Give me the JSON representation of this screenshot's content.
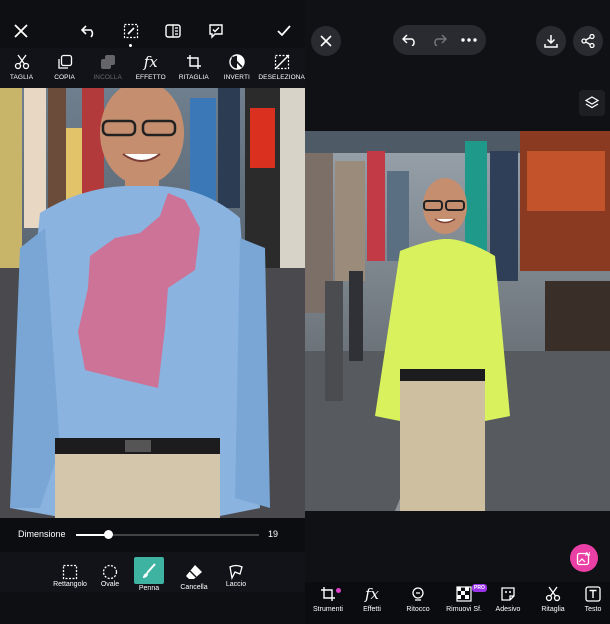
{
  "left": {
    "toolbar_tools": [
      {
        "label": "TAGLIA",
        "icon": "scissors-icon"
      },
      {
        "label": "COPIA",
        "icon": "copy-icon"
      },
      {
        "label": "INCOLLA",
        "icon": "paste-icon"
      },
      {
        "label": "EFFETTO",
        "icon": "fx-icon"
      },
      {
        "label": "RITAGLIA",
        "icon": "crop-icon"
      },
      {
        "label": "INVERTI",
        "icon": "invert-icon"
      },
      {
        "label": "DESELEZIONA",
        "icon": "deselect-icon"
      }
    ],
    "brush_size": {
      "label": "Dimensione",
      "value": "19",
      "fraction": 0.18
    },
    "selection_tools": [
      {
        "label": "Rettangolo",
        "icon": "rectangle-select-icon"
      },
      {
        "label": "Ovale",
        "icon": "oval-select-icon"
      },
      {
        "label": "Penna",
        "icon": "brush-icon",
        "active": true
      },
      {
        "label": "Cancella",
        "icon": "eraser-icon"
      },
      {
        "label": "Laccio",
        "icon": "lasso-icon"
      }
    ],
    "colors": {
      "shirt": "#8bb3e0",
      "mask": "#d66a8c",
      "accent": "#3fb3a2"
    }
  },
  "right": {
    "bottom_tools": [
      {
        "label": "Strumenti",
        "icon": "crop-icon"
      },
      {
        "label": "Effetti",
        "icon": "fx-icon"
      },
      {
        "label": "Ritocco",
        "icon": "retouch-icon"
      },
      {
        "label": "Rimuovi Sf.",
        "icon": "remove-bg-icon",
        "badge": "PRO"
      },
      {
        "label": "Adesivo",
        "icon": "sticker-icon"
      },
      {
        "label": "Ritaglia",
        "icon": "scissors-icon"
      },
      {
        "label": "Testo",
        "icon": "text-icon"
      }
    ],
    "colors": {
      "shirt": "#d8f15c",
      "ai_button": "#ea3fa5",
      "pro_badge": "#9b34e8"
    }
  }
}
